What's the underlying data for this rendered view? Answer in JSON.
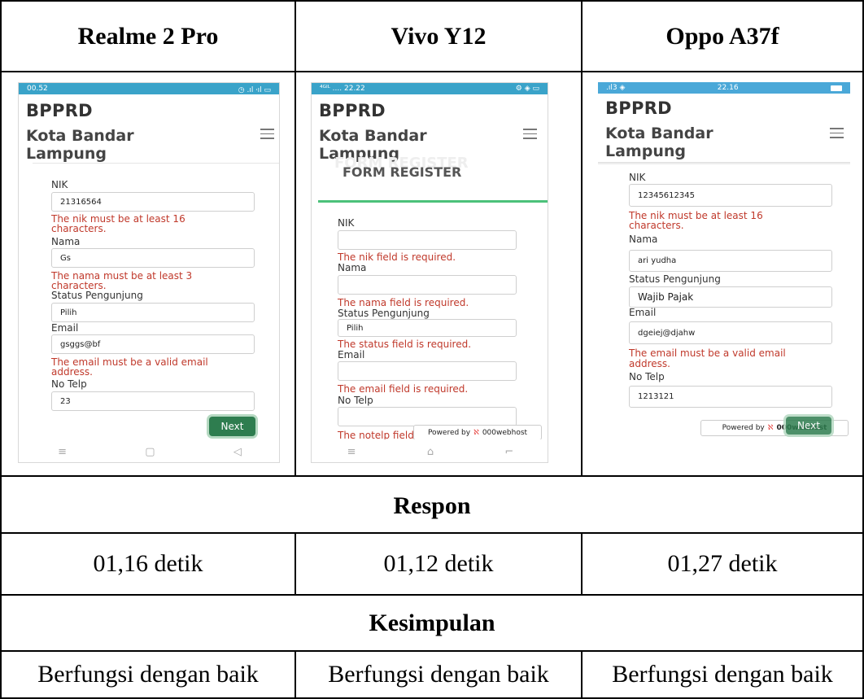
{
  "headers": [
    "Realme 2 Pro",
    "Vivo Y12",
    "Oppo A37f"
  ],
  "section_respon": "Respon",
  "respon_values": [
    "01,16 detik",
    "01,12 detik",
    "01,27 detik"
  ],
  "section_kesimpulan": "Kesimpulan",
  "kesimpulan_values": [
    "Berfungsi dengan baik",
    "Berfungsi dengan baik",
    "Berfungsi dengan baik"
  ],
  "app": {
    "brand": "BPPRD",
    "sub1": "Kota Bandar",
    "sub2": "Lampung"
  },
  "labels": {
    "nik": "NIK",
    "nama": "Nama",
    "status": "Status Pengunjung",
    "email": "Email",
    "telp": "No Telp",
    "next": "Next",
    "powered_by": "Powered by",
    "host": "000webhost"
  },
  "realme": {
    "time": "00.52",
    "status_icons": "◷ .ıl ⸱ıl ▭",
    "nik_value": "21316564",
    "nik_error_1": "The nik must be at least 16",
    "nik_error_2": "characters.",
    "nama_value": "Gs",
    "nama_error_1": "The nama must be at least 3",
    "nama_error_2": "characters.",
    "status_value": "Pilih",
    "email_value": "gsggs@bf",
    "email_error_1": "The email must be a valid email",
    "email_error_2": "address.",
    "telp_value": "23",
    "nav": [
      "≡",
      "▢",
      "◁"
    ]
  },
  "vivo": {
    "time": "⁴ᴳᴵᴸ .... 22.22",
    "status_icons": "⚙ ◈ ▭",
    "ghost_text": "FORM REGISTER",
    "form_title": "FORM REGISTER",
    "nik_error": "The nik field is required.",
    "nama_error": "The nama field is required.",
    "status_value": "Pilih",
    "status_error": "The status field is required.",
    "email_error": "The email field is required.",
    "telp_error": "The notelp field",
    "nav": [
      "≡",
      "⌂",
      "⌐"
    ]
  },
  "oppo": {
    "time": "22.16",
    "signal": ".ıl3 ◈",
    "nik_value": "12345612345",
    "nik_error_1": "The nik must be at least 16",
    "nik_error_2": "characters.",
    "nama_value": "ari yudha",
    "status_value": "Wajib Pajak",
    "email_value": "dgeiej@djahw",
    "email_error_1": "The email must be a valid email",
    "email_error_2": "address.",
    "telp_value": "1213121"
  },
  "colors": {
    "realme_status": "#3aa3c9",
    "vivo_status": "#3aa3c9",
    "oppo_status": "#4aa8d8",
    "error": "#c0392b",
    "button": "#2e7d4f"
  }
}
